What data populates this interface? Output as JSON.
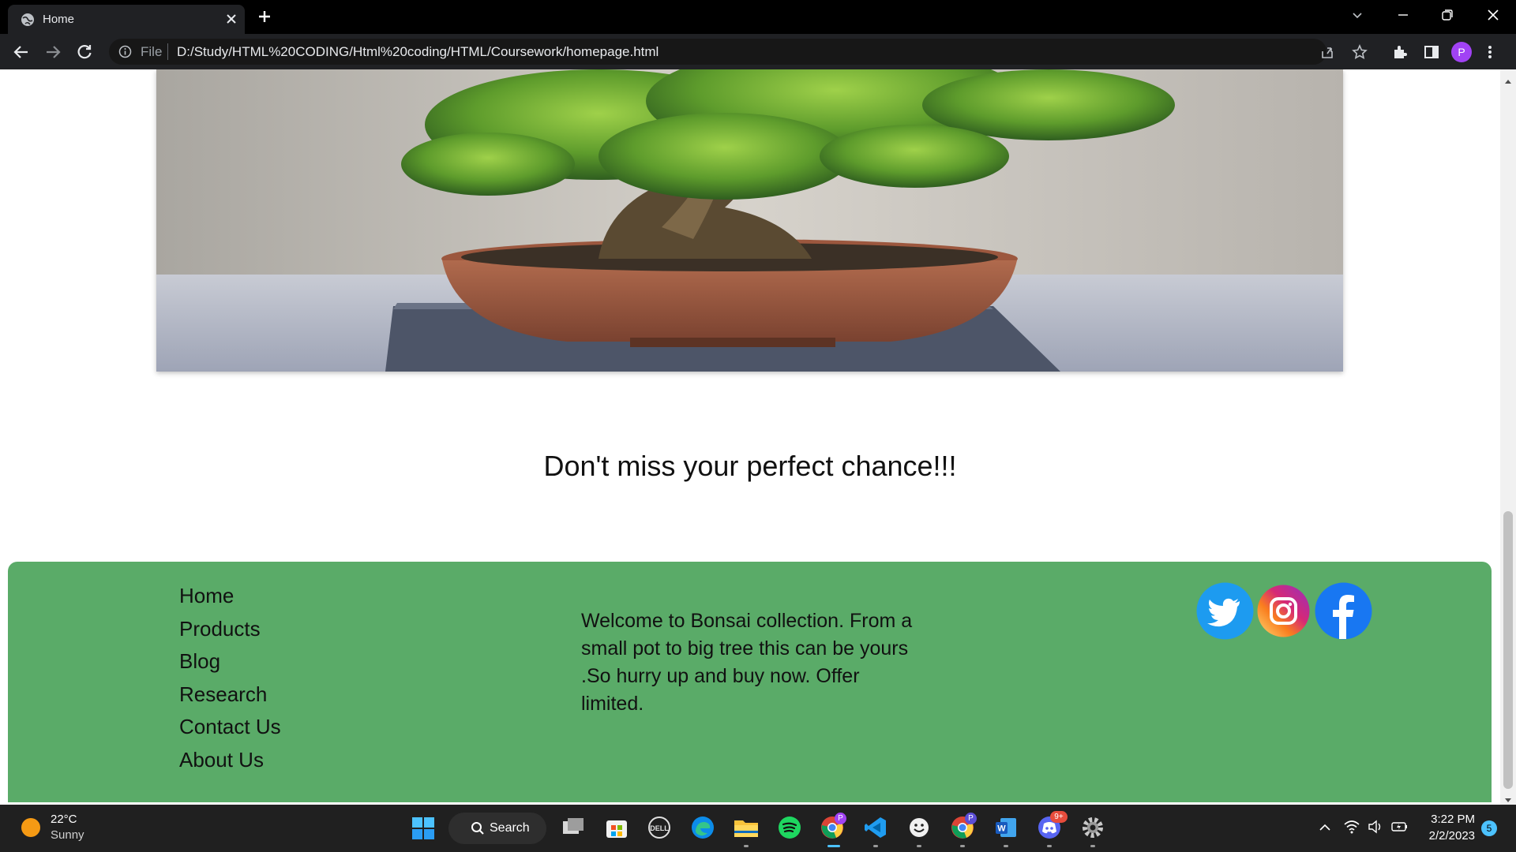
{
  "browser": {
    "tab_title": "Home",
    "omnibox_prefix": "File",
    "url": "D:/Study/HTML%20CODING/Html%20coding/HTML/Coursework/homepage.html",
    "profile_initial": "P"
  },
  "page": {
    "hero_alt": "Bonsai tree in pot",
    "tagline": "Don't miss your perfect chance!!!",
    "footer": {
      "nav": [
        "Home",
        "Products",
        "Blog",
        "Research",
        "Contact Us",
        "About Us"
      ],
      "text": "Welcome to Bonsai collection. From a small pot to big tree this can be yours .So hurry up and buy now. Offer limited.",
      "social": [
        "twitter-icon",
        "instagram-icon",
        "facebook-icon"
      ],
      "bg_color": "#5aab68"
    }
  },
  "taskbar": {
    "weather_temp": "22°C",
    "weather_desc": "Sunny",
    "search_label": "Search",
    "time": "3:22 PM",
    "date": "2/2/2023",
    "notification_count": "5",
    "chrome_badge": "P",
    "discord_badge": "9+"
  }
}
